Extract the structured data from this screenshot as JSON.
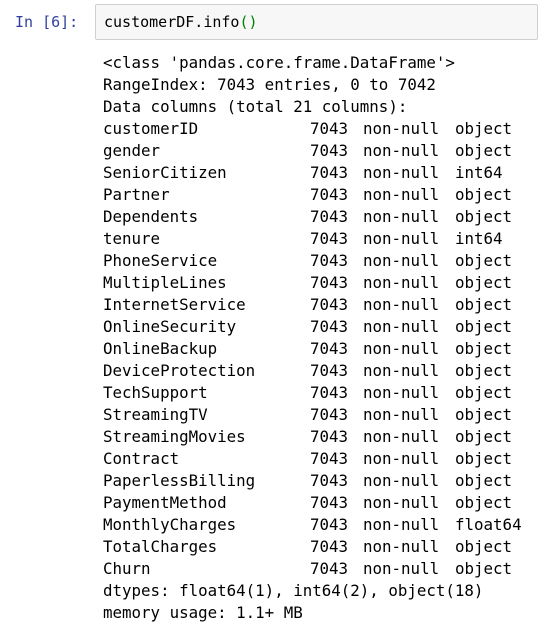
{
  "input": {
    "prompt": "In [6]:",
    "code_text": "customerDF.info",
    "code_parens": "()"
  },
  "output": {
    "header_lines": [
      "<class 'pandas.core.frame.DataFrame'>",
      "RangeIndex: 7043 entries, 0 to 7042",
      "Data columns (total 21 columns):"
    ],
    "columns": [
      {
        "name": "customerID",
        "count": "7043",
        "nonnull": "non-null",
        "dtype": "object"
      },
      {
        "name": "gender",
        "count": "7043",
        "nonnull": "non-null",
        "dtype": "object"
      },
      {
        "name": "SeniorCitizen",
        "count": "7043",
        "nonnull": "non-null",
        "dtype": "int64"
      },
      {
        "name": "Partner",
        "count": "7043",
        "nonnull": "non-null",
        "dtype": "object"
      },
      {
        "name": "Dependents",
        "count": "7043",
        "nonnull": "non-null",
        "dtype": "object"
      },
      {
        "name": "tenure",
        "count": "7043",
        "nonnull": "non-null",
        "dtype": "int64"
      },
      {
        "name": "PhoneService",
        "count": "7043",
        "nonnull": "non-null",
        "dtype": "object"
      },
      {
        "name": "MultipleLines",
        "count": "7043",
        "nonnull": "non-null",
        "dtype": "object"
      },
      {
        "name": "InternetService",
        "count": "7043",
        "nonnull": "non-null",
        "dtype": "object"
      },
      {
        "name": "OnlineSecurity",
        "count": "7043",
        "nonnull": "non-null",
        "dtype": "object"
      },
      {
        "name": "OnlineBackup",
        "count": "7043",
        "nonnull": "non-null",
        "dtype": "object"
      },
      {
        "name": "DeviceProtection",
        "count": "7043",
        "nonnull": "non-null",
        "dtype": "object"
      },
      {
        "name": "TechSupport",
        "count": "7043",
        "nonnull": "non-null",
        "dtype": "object"
      },
      {
        "name": "StreamingTV",
        "count": "7043",
        "nonnull": "non-null",
        "dtype": "object"
      },
      {
        "name": "StreamingMovies",
        "count": "7043",
        "nonnull": "non-null",
        "dtype": "object"
      },
      {
        "name": "Contract",
        "count": "7043",
        "nonnull": "non-null",
        "dtype": "object"
      },
      {
        "name": "PaperlessBilling",
        "count": "7043",
        "nonnull": "non-null",
        "dtype": "object"
      },
      {
        "name": "PaymentMethod",
        "count": "7043",
        "nonnull": "non-null",
        "dtype": "object"
      },
      {
        "name": "MonthlyCharges",
        "count": "7043",
        "nonnull": "non-null",
        "dtype": "float64"
      },
      {
        "name": "TotalCharges",
        "count": "7043",
        "nonnull": "non-null",
        "dtype": "object"
      },
      {
        "name": "Churn",
        "count": "7043",
        "nonnull": "non-null",
        "dtype": "object"
      }
    ],
    "footer_lines": [
      "dtypes: float64(1), int64(2), object(18)",
      "memory usage: 1.1+ MB"
    ]
  },
  "colors": {
    "prompt": "#303f9f",
    "input_background": "#f7f7f7",
    "input_border": "#cfcfcf",
    "paren": "#008000",
    "text": "#000000"
  }
}
